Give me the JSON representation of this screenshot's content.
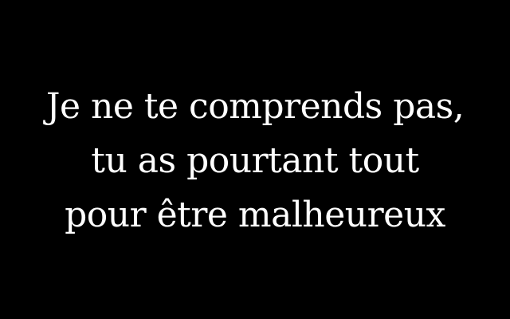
{
  "quote": {
    "lines": [
      "Je ne te comprends pas,",
      "tu as pourtant tout",
      "pour être malheureux"
    ]
  },
  "colors": {
    "background": "#000000",
    "text": "#ffffff"
  }
}
